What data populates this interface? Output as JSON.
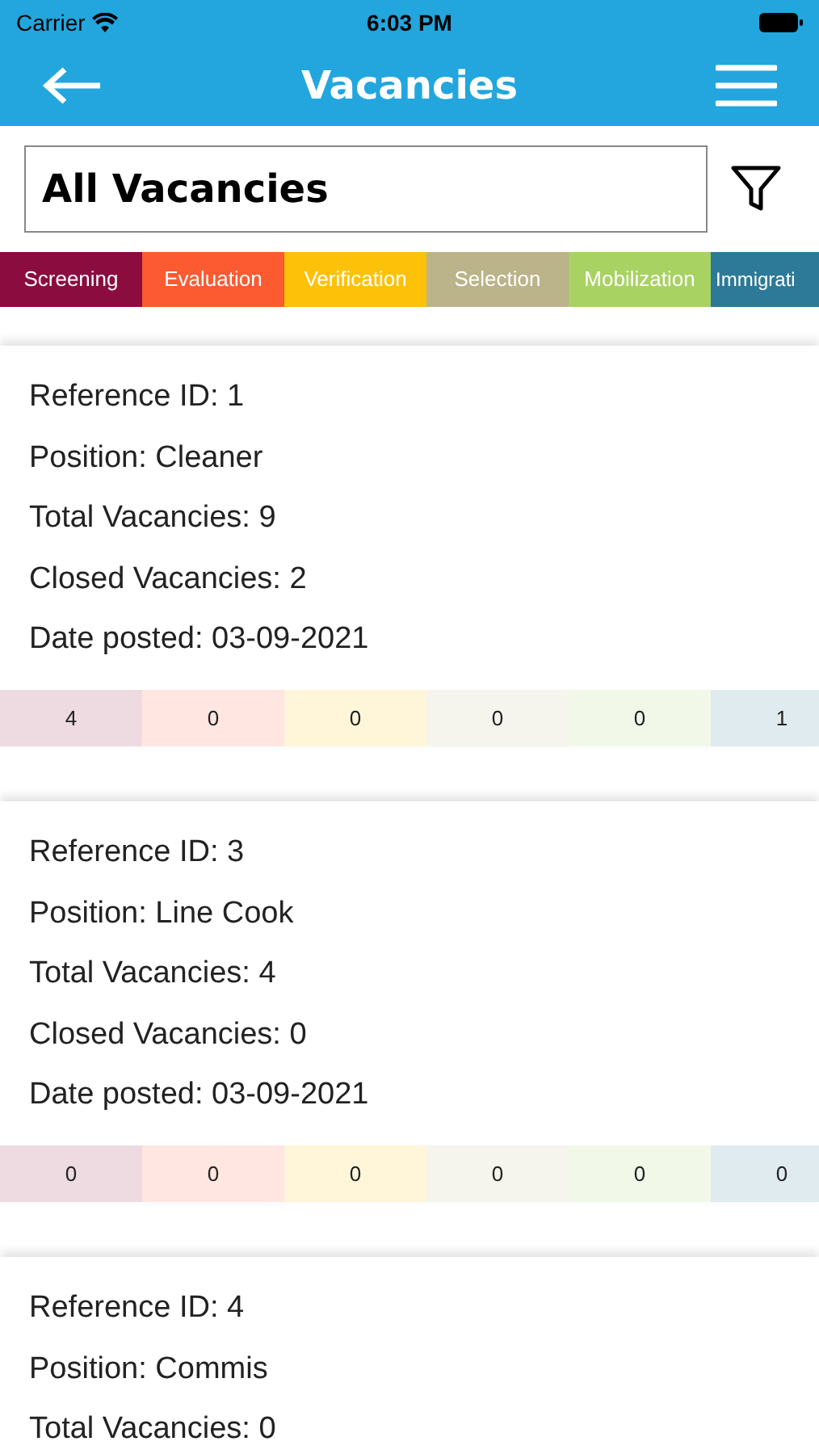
{
  "status_bar": {
    "carrier": "Carrier",
    "time": "6:03 PM"
  },
  "nav": {
    "title": "Vacancies"
  },
  "filter": {
    "value": "All Vacancies"
  },
  "stages": [
    {
      "label": "Screening",
      "color": "#8b0c3f"
    },
    {
      "label": "Evaluation",
      "color": "#fc5a31"
    },
    {
      "label": "Verification",
      "color": "#fec10a"
    },
    {
      "label": "Selection",
      "color": "#bbb389"
    },
    {
      "label": "Mobilization",
      "color": "#a8d262"
    },
    {
      "label": "Immigrati",
      "color": "#2c7a98"
    }
  ],
  "vacancies": [
    {
      "lines": [
        "Reference ID: 1",
        "Position: Cleaner",
        "Total Vacancies: 9",
        "Closed Vacancies: 2",
        "Date posted: 03-09-2021"
      ],
      "counts": [
        "4",
        "0",
        "0",
        "0",
        "0",
        "1"
      ]
    },
    {
      "lines": [
        "Reference ID: 3",
        "Position: Line Cook",
        "Total Vacancies: 4",
        "Closed Vacancies: 0",
        "Date posted: 03-09-2021"
      ],
      "counts": [
        "0",
        "0",
        "0",
        "0",
        "0",
        "0"
      ]
    },
    {
      "lines": [
        "Reference ID: 4",
        "Position: Commis",
        "Total Vacancies: 0"
      ]
    }
  ]
}
